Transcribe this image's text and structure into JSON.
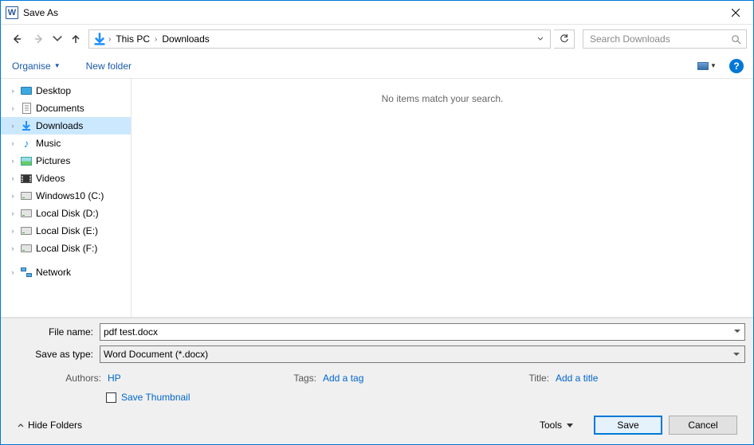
{
  "title": "Save As",
  "nav": {
    "back_enabled": true,
    "forward_enabled": false,
    "up_enabled": true
  },
  "breadcrumb": {
    "items": [
      "This PC",
      "Downloads"
    ]
  },
  "search": {
    "placeholder": "Search Downloads"
  },
  "toolbar": {
    "organise": "Organise",
    "new_folder": "New folder"
  },
  "tree": {
    "items": [
      {
        "label": "Desktop",
        "icon": "monitor",
        "expandable": true
      },
      {
        "label": "Documents",
        "icon": "doc",
        "expandable": true
      },
      {
        "label": "Downloads",
        "icon": "download",
        "expandable": true,
        "selected": true
      },
      {
        "label": "Music",
        "icon": "music",
        "expandable": true
      },
      {
        "label": "Pictures",
        "icon": "pic",
        "expandable": true
      },
      {
        "label": "Videos",
        "icon": "video",
        "expandable": true
      },
      {
        "label": "Windows10 (C:)",
        "icon": "disk",
        "expandable": true
      },
      {
        "label": "Local Disk (D:)",
        "icon": "disk",
        "expandable": true
      },
      {
        "label": "Local Disk (E:)",
        "icon": "disk",
        "expandable": true
      },
      {
        "label": "Local Disk (F:)",
        "icon": "disk",
        "expandable": true
      }
    ],
    "network": {
      "label": "Network",
      "icon": "network",
      "expandable": true
    }
  },
  "contents": {
    "empty_text": "No items match your search."
  },
  "fields": {
    "filename_label": "File name:",
    "filename_value": "pdf test.docx",
    "savetype_label": "Save as type:",
    "savetype_value": "Word Document (*.docx)"
  },
  "meta": {
    "authors_label": "Authors:",
    "authors_value": "HP",
    "tags_label": "Tags:",
    "tags_placeholder": "Add a tag",
    "title_label": "Title:",
    "title_placeholder": "Add a title",
    "save_thumbnail": "Save Thumbnail"
  },
  "footer": {
    "hide_folders": "Hide Folders",
    "tools": "Tools",
    "save": "Save",
    "cancel": "Cancel"
  }
}
